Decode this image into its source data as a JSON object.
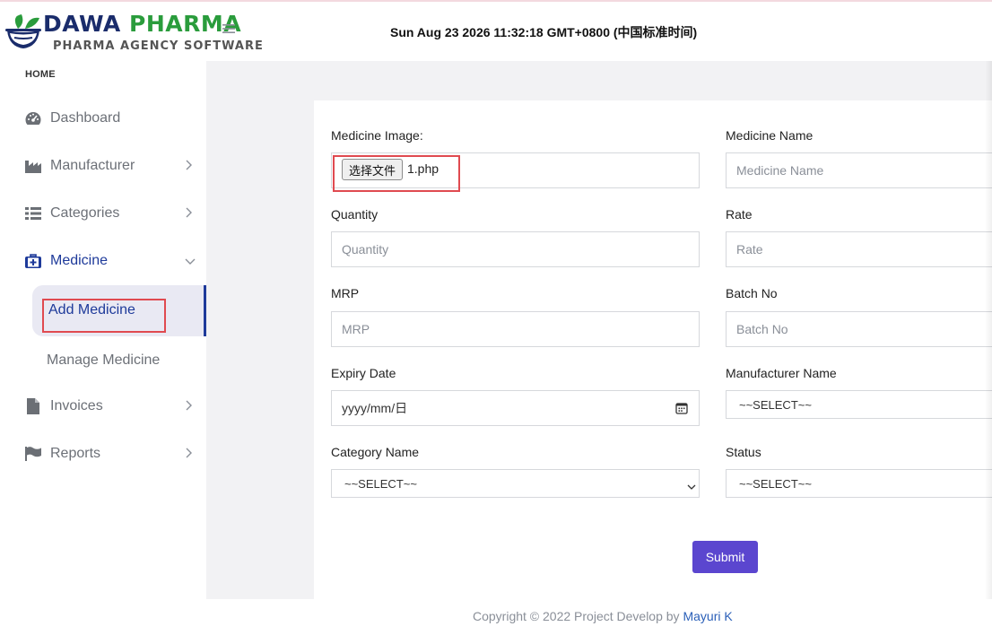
{
  "brand": {
    "name_part1": "DAWA",
    "name_part2": "PHARMA",
    "tagline": "PHARMA AGENCY SOFTWARE"
  },
  "header": {
    "datetime": "Sun Aug 23 2026 11:32:18 GMT+0800 (中国标准时间)"
  },
  "sidebar": {
    "heading": "HOME",
    "items": [
      {
        "label": "Dashboard",
        "icon": "dashboard-gauge-icon"
      },
      {
        "label": "Manufacturer",
        "icon": "industry-icon"
      },
      {
        "label": "Categories",
        "icon": "list-icon"
      },
      {
        "label": "Medicine",
        "icon": "medkit-icon"
      },
      {
        "label": "Invoices",
        "icon": "file-icon"
      },
      {
        "label": "Reports",
        "icon": "flag-icon"
      }
    ],
    "medicine_sub": {
      "active_label": "Add Medicine",
      "other_label": "Manage Medicine"
    }
  },
  "form": {
    "medicine_image_label": "Medicine Image:",
    "file_button_label": "选择文件",
    "file_name": "1.php",
    "medicine_name_label": "Medicine Name",
    "medicine_name_placeholder": "Medicine Name",
    "quantity_label": "Quantity",
    "quantity_placeholder": "Quantity",
    "rate_label": "Rate",
    "rate_placeholder": "Rate",
    "mrp_label": "MRP",
    "mrp_placeholder": "MRP",
    "batch_label": "Batch No",
    "batch_placeholder": "Batch No",
    "expiry_label": "Expiry Date",
    "expiry_placeholder": "yyyy/mm/日",
    "manufacturer_label": "Manufacturer Name",
    "manufacturer_value": "~~SELECT~~",
    "category_label": "Category Name",
    "category_value": "~~SELECT~~",
    "status_label": "Status",
    "status_value": "~~SELECT~~",
    "submit_label": "Submit"
  },
  "footer": {
    "text": "Copyright © 2022 Project Develop by",
    "author": "Mayuri K"
  },
  "colors": {
    "accent": "#5b46cf",
    "active_nav": "#1e3a9a",
    "highlight_box": "#e04a50",
    "brand_green": "#2a9c3c",
    "brand_navy": "#1a2c6b"
  }
}
